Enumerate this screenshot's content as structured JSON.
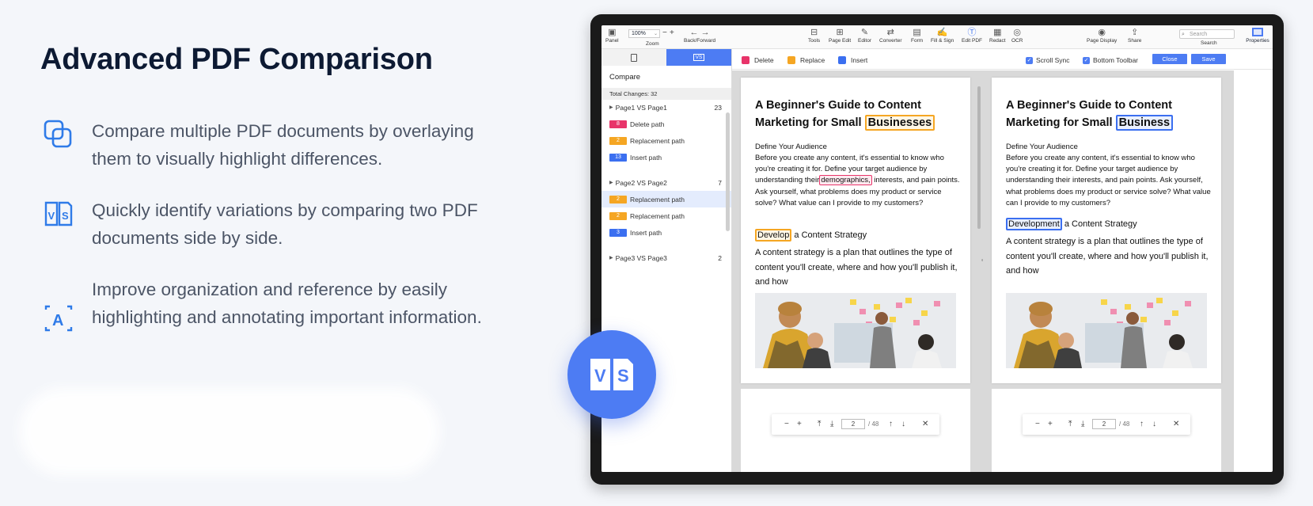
{
  "hero": {
    "title": "Advanced PDF Comparison",
    "features": [
      {
        "text": "Compare multiple PDF documents by overlaying them to visually highlight differences.",
        "icon": "overlay-squares-icon"
      },
      {
        "text": "Quickly identify variations by comparing two PDF documents side by side.",
        "icon": "vs-document-icon"
      },
      {
        "text": "Improve organization and reference by easily highlighting and annotating important information.",
        "icon": "text-a-icon"
      }
    ],
    "badge_label": "VS"
  },
  "toolbar": {
    "panel": "Panel",
    "zoom_value": "100%",
    "zoom_label": "Zoom",
    "back_forward": "Back/Forward",
    "tools": "Tools",
    "page_edit": "Page Edit",
    "editor": "Editor",
    "converter": "Converter",
    "form": "Form",
    "fill_sign": "Fill & Sign",
    "edit_pdf": "Edit PDF",
    "redact": "Redact",
    "ocr": "OCR",
    "page_display": "Page Display",
    "share": "Share",
    "search_placeholder": "Search",
    "search_label": "Search",
    "properties": "Properties"
  },
  "sidebar": {
    "tab_vs": "VS",
    "heading": "Compare",
    "total": "Total Changes: 32",
    "groups": [
      {
        "title": "Page1 VS Page1",
        "count": "23",
        "changes": [
          {
            "chip": "8",
            "label": "Delete path",
            "type": "delete"
          },
          {
            "chip": "2",
            "label": "Replacement path",
            "type": "replace"
          },
          {
            "chip": "13",
            "label": "Insert path",
            "type": "insert"
          }
        ]
      },
      {
        "title": "Page2 VS Page2",
        "count": "7",
        "changes": [
          {
            "chip": "2",
            "label": "Replacement path",
            "type": "replace"
          },
          {
            "chip": "2",
            "label": "Replacement path",
            "type": "replace"
          },
          {
            "chip": "3",
            "label": "Insert path",
            "type": "insert"
          }
        ]
      },
      {
        "title": "Page3 VS Page3",
        "count": "2",
        "changes": []
      }
    ]
  },
  "legend": {
    "delete": "Delete",
    "replace": "Replace",
    "insert": "Insert",
    "scroll_sync": "Scroll Sync",
    "bottom_toolbar": "Bottom Toolbar",
    "close": "Close",
    "save": "Save"
  },
  "colors": {
    "delete": "#e8346a",
    "replace": "#f5a623",
    "insert": "#3b6ff0",
    "accent": "#4d7cf3"
  },
  "doc_left": {
    "title_a": "A Beginner's Guide to Content Marketing for Small",
    "title_hl": "Businesses",
    "subheading": "Define Your Audience",
    "body_a": "Before you create any content, it's essential to know who you're creating it for. Define your target audience by understanding their",
    "body_hl": "demographics,",
    "body_b": " interests, and pain points. Ask yourself, what problems does my product or service solve? What value can I provide to my customers?",
    "h2_hl": "Develop",
    "h2_rest": " a Content Strategy",
    "body2": "A content strategy is a plan that outlines the type of content you'll create, where and how you'll publish it, and how"
  },
  "doc_right": {
    "title_a": "A Beginner's Guide to Content Marketing for Small",
    "title_hl": "Business",
    "subheading": "Define Your Audience",
    "body": "Before you create any content, it's essential to know who you're creating it for. Define your target audience by understanding their interests, and pain points. Ask yourself, what problems does my product or service solve? What value can I provide to my customers?",
    "h2_hl": "Development",
    "h2_rest": " a Content Strategy",
    "body2": "A content strategy is a plan that outlines the type of content you'll create, where and how you'll publish it, and how"
  },
  "pager": {
    "page": "2",
    "total": "/ 48"
  }
}
